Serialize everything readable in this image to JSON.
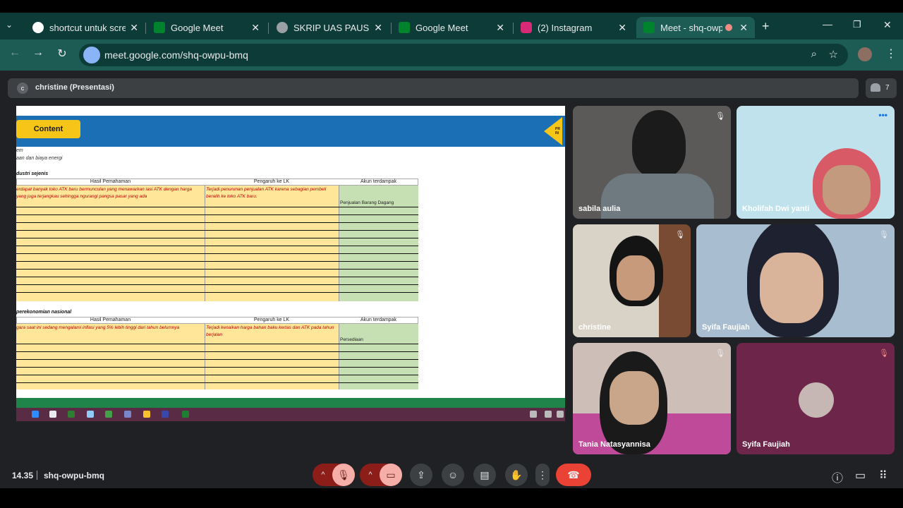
{
  "tabs": [
    {
      "label": "shortcut untuk screen",
      "icon": "google-icon"
    },
    {
      "label": "Google Meet",
      "icon": "meet-icon"
    },
    {
      "label": "SKRIP UAS PAUS.pdf",
      "icon": "globe-icon"
    },
    {
      "label": "Google Meet",
      "icon": "meet-icon"
    },
    {
      "label": "(2) Instagram",
      "icon": "instagram-icon"
    },
    {
      "label": "Meet - shq-owpu",
      "icon": "meet-icon",
      "active": true
    }
  ],
  "toolbar": {
    "url": "meet.google.com/shq-owpu-bmq"
  },
  "meet": {
    "presenter": {
      "avatar": "c",
      "label": "christine (Presentasi)"
    },
    "people_count": "7",
    "participants": [
      {
        "name": "sabila aulia"
      },
      {
        "name": "Kholifah Dwi yanti"
      },
      {
        "name": "christine"
      },
      {
        "name": "Syifa Faujiah"
      },
      {
        "name": "Tania Natasyannisa"
      },
      {
        "name": "Syifa Faujiah"
      }
    ],
    "time": "14.35",
    "code": "shq-owpu-bmq"
  },
  "slide": {
    "content_button": "Content",
    "arrow_text": "PR IN",
    "line1": "em",
    "line2": "aan dan biaya energi",
    "section1": "dustri sejenis",
    "section2": "perekonomian nasional",
    "headers": [
      "Hasil Pemahaman",
      "Pengaruh ke LK",
      "Akun terdampak"
    ],
    "t1_col1": "erdapat banyak toko ATK baru bermunculan yang menawarkan iasi ATK dengan harga yang juga terjangkau sehingga ngurangi pangsa pasar yang ada",
    "t1_col2": "Terjadi penurunan penjualan ATK karena sebagian pembeli beralih ke toko ATK baru.",
    "t1_col3": "Penjualan Barang Dagang",
    "t2_col1": "gara saat ini sedang mengalami inflasi yang 5% lebih tinggi dari tahun belumnya",
    "t2_col2": "Terjadi kenaikan harga bahan baku kertas dan ATK pada tahun berjalan",
    "t2_col3": "Persediaan"
  }
}
